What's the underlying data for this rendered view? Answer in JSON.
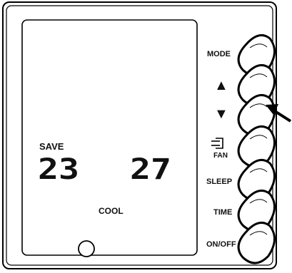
{
  "display": {
    "save_label": "SAVE",
    "temp_left": "23",
    "temp_right": "27",
    "mode_label": "COOL"
  },
  "buttons": {
    "mode": {
      "label": "MODE"
    },
    "up": {
      "glyph": "▲"
    },
    "down": {
      "glyph": "▼"
    },
    "fan": {
      "label": "FAN",
      "icon": "fan-icon"
    },
    "sleep": {
      "label": "SLEEP"
    },
    "time": {
      "label": "TIME"
    },
    "power": {
      "label": "ON/OFF"
    }
  },
  "colors": {
    "ink": "#000000",
    "background": "#ffffff"
  }
}
